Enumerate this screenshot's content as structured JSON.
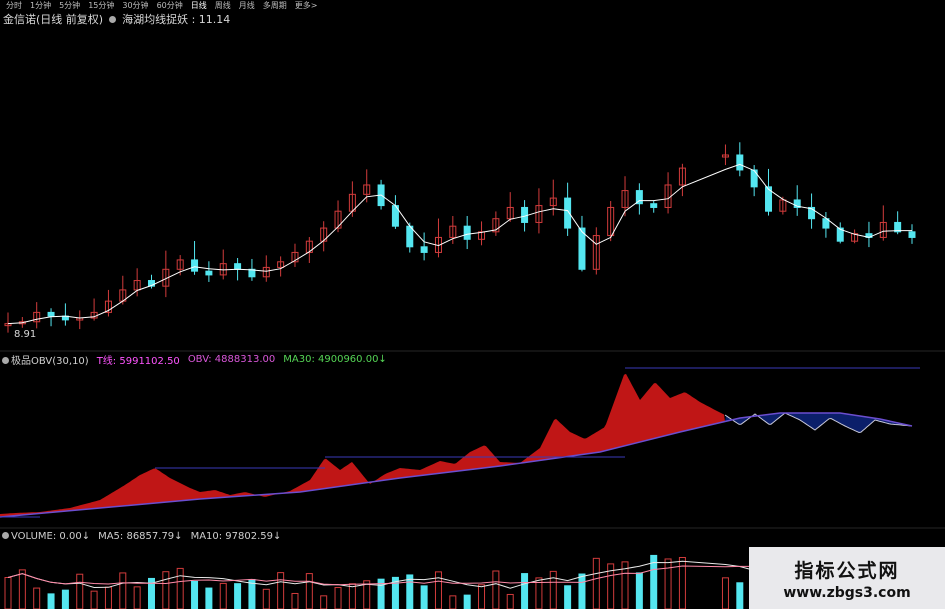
{
  "period_tabs": [
    {
      "label": "分时",
      "active": false
    },
    {
      "label": "1分钟",
      "active": false
    },
    {
      "label": "5分钟",
      "active": false
    },
    {
      "label": "15分钟",
      "active": false
    },
    {
      "label": "30分钟",
      "active": false
    },
    {
      "label": "60分钟",
      "active": false
    },
    {
      "label": "日线",
      "active": true
    },
    {
      "label": "周线",
      "active": false
    },
    {
      "label": "月线",
      "active": false
    },
    {
      "label": "多周期",
      "active": false
    },
    {
      "label": "更多>",
      "active": false
    }
  ],
  "main": {
    "stock_name": "金信诺(日线 前复权)",
    "indicator": "海湖均线捉妖 : 11.14",
    "low_price_label": "8.91"
  },
  "obv": {
    "name": "极品OBV(30,10)",
    "t_label": "T线: 5991102.50",
    "obv_label": "OBV: 4888313.00",
    "ma30_label": "MA30: 4900960.00↓"
  },
  "volume": {
    "name": "VOLUME: 0.00↓",
    "ma5_label": "MA5: 86857.79↓",
    "ma10_label": "MA10: 97802.59↓"
  },
  "watermark": {
    "title": "指标公式网",
    "url": "www.zbgs3.com"
  },
  "colors": {
    "up": "#d23c3c",
    "down": "#54e6f0",
    "ma_line": "#ffffff",
    "obv_fill_up": "#c01616",
    "obv_fill_down": "#0b1f6a",
    "ma30": "#6b4ecf",
    "t_line": "#3a3ab8",
    "t_color": "#ff55ff",
    "obv_color": "#d957d9",
    "ma30_text": "#55d455"
  },
  "chart_data": [
    {
      "type": "candlestick",
      "title": "金信诺(日线 前复权)",
      "y_annotation": "8.91",
      "close_series": [
        9.0,
        9.1,
        9.6,
        9.4,
        9.2,
        9.3,
        9.6,
        10.2,
        10.8,
        11.3,
        11.0,
        11.9,
        12.4,
        11.8,
        11.6,
        12.2,
        11.9,
        11.5,
        12.0,
        12.3,
        12.8,
        13.4,
        14.1,
        15.0,
        15.9,
        16.4,
        15.3,
        14.2,
        13.1,
        12.8,
        13.6,
        14.2,
        13.5,
        13.9,
        14.6,
        15.2,
        14.4,
        15.3,
        15.7,
        14.1,
        11.9,
        13.7,
        15.2,
        16.1,
        15.4,
        15.2,
        16.4,
        17.3,
        null,
        null,
        18.0,
        17.2,
        16.3,
        15.0,
        15.6,
        15.2,
        14.6,
        14.1,
        13.4,
        13.8,
        13.6,
        14.4,
        13.9,
        13.6
      ]
    },
    {
      "type": "area",
      "title": "极品OBV(30,10)",
      "series": [
        {
          "name": "T线",
          "value": 5991102.5
        },
        {
          "name": "OBV",
          "value": 4888313.0
        },
        {
          "name": "MA30",
          "value": 4900960.0
        }
      ]
    },
    {
      "type": "bar",
      "title": "VOLUME",
      "series": [
        {
          "name": "MA5",
          "value": 86857.79
        },
        {
          "name": "MA10",
          "value": 97802.59
        }
      ]
    }
  ]
}
